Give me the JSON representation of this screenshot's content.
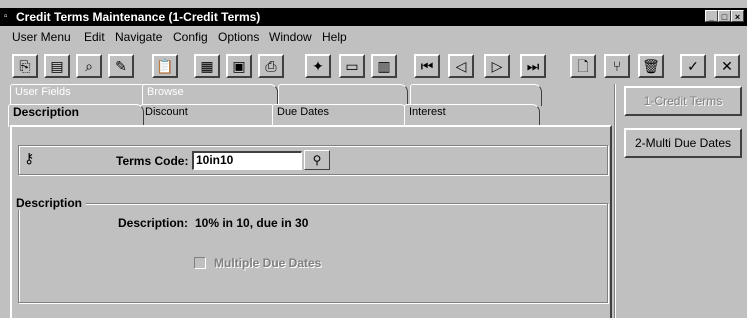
{
  "window": {
    "title": "Credit Terms Maintenance (1-Credit Terms)",
    "controls": [
      "_",
      "□",
      "×"
    ]
  },
  "menu": [
    "User Menu",
    "Edit",
    "Navigate",
    "Config",
    "Options",
    "Window",
    "Help"
  ],
  "toolbar": {
    "icons": [
      {
        "name": "copy-icon",
        "glyph": "⎘"
      },
      {
        "name": "paste-icon",
        "glyph": "▤"
      },
      {
        "name": "find-icon",
        "glyph": "⌕"
      },
      {
        "name": "edit-icon",
        "glyph": "✎"
      },
      {
        "name": "clipboard-icon",
        "glyph": "📋"
      },
      {
        "name": "calculator-icon",
        "glyph": "▦"
      },
      {
        "name": "calendar-icon",
        "glyph": "▣"
      },
      {
        "name": "print-icon",
        "glyph": "⎙"
      },
      {
        "name": "magic-icon",
        "glyph": "✦"
      },
      {
        "name": "report-icon",
        "glyph": "▭"
      },
      {
        "name": "chart-icon",
        "glyph": "▥"
      },
      {
        "name": "first-record-icon",
        "glyph": "⏮"
      },
      {
        "name": "prev-record-icon",
        "glyph": "◁"
      },
      {
        "name": "next-record-icon",
        "glyph": "▷"
      },
      {
        "name": "last-record-icon",
        "glyph": "⏭"
      },
      {
        "name": "new-icon",
        "glyph": "🗋"
      },
      {
        "name": "attach-icon",
        "glyph": "⑂"
      },
      {
        "name": "delete-icon",
        "glyph": "🗑"
      },
      {
        "name": "save-icon",
        "glyph": "✓"
      },
      {
        "name": "cancel-icon",
        "glyph": "✕"
      }
    ]
  },
  "tabs": {
    "back_row": [
      "User Fields",
      "Browse",
      "",
      ""
    ],
    "front_row": [
      "Description",
      "Discount",
      "Due Dates",
      "Interest"
    ]
  },
  "form": {
    "terms_code_label": "Terms Code:",
    "terms_code_value": "10in10",
    "lookup_icon": "binoculars-icon",
    "group_title": "Description",
    "description_label": "Description:",
    "description_value": "10% in 10, due in 30",
    "multiple_due_dates_label": "Multiple Due Dates",
    "multiple_due_dates_checked": false
  },
  "side_buttons": {
    "credit_terms": "1-Credit Terms",
    "multi_due_dates": "2-Multi Due Dates"
  }
}
